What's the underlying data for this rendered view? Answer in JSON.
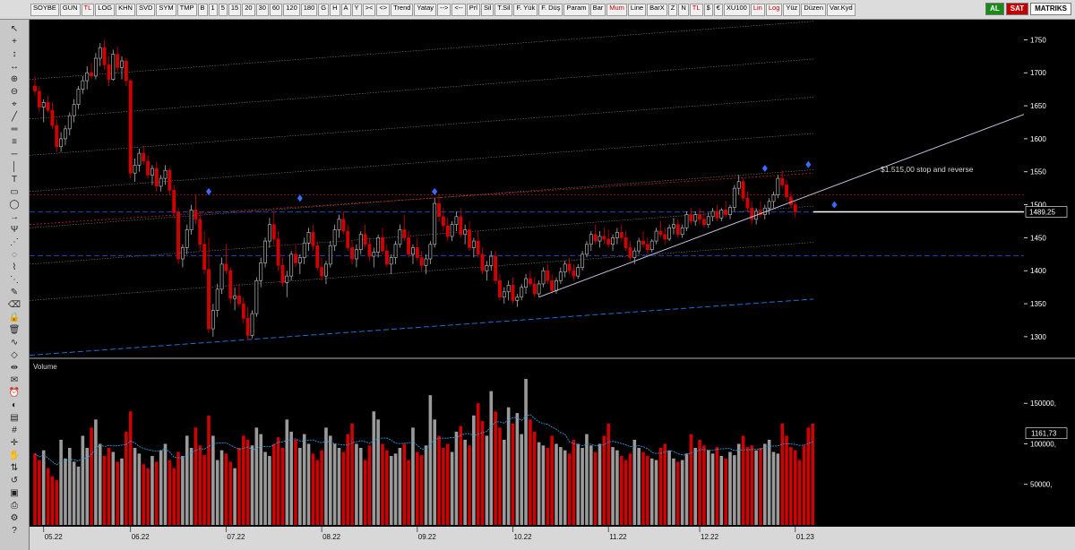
{
  "toolbar": {
    "symbol": "SOYBE",
    "period": "GUN",
    "currency": "TL",
    "row1": [
      "B",
      "1",
      "5",
      "15",
      "20",
      "30",
      "60",
      "120",
      "180",
      "G",
      "H",
      "A",
      "Y",
      "><",
      "<>",
      "Trend",
      "Yatay",
      "-->",
      "<--",
      "Prl",
      "Sil",
      "T.Sil",
      "F. Yük",
      "F. Düş",
      "Param",
      "Bar",
      "Mum",
      "Line",
      "BarX",
      "Z",
      "N",
      "TL",
      "$",
      "€",
      "XU100",
      "Lin",
      "Log",
      "Yüz",
      "Düzen",
      "Var.Kyd"
    ],
    "row0": [
      "LOG",
      "KHN",
      "SVD",
      "SYM",
      "TMP"
    ],
    "red_items": [
      "Mum",
      "TL",
      "Lin",
      "Log"
    ],
    "al_label": "AL",
    "sat_label": "SAT",
    "brand": "MATRIKS"
  },
  "tools": [
    "pointer",
    "plus",
    "arrow-up-down",
    "arrow-left-right",
    "zoom-icon",
    "zoom-out",
    "magnet",
    "trendline",
    "channel",
    "fib",
    "hline",
    "vline",
    "text",
    "rect",
    "ellipse",
    "arrow",
    "pitchfork",
    "gann",
    "cycle",
    "regression",
    "speedline",
    "brush",
    "eraser",
    "lock",
    "trash",
    "wave",
    "pattern",
    "measure",
    "note",
    "alarm",
    "color",
    "style",
    "grid",
    "crosshair",
    "hand",
    "scroll",
    "reset",
    "save",
    "print",
    "settings",
    "help"
  ],
  "chart_data": {
    "type": "candlestick",
    "symbol": "SOYBE",
    "price_axis": {
      "min": 1270,
      "max": 1775,
      "ticks": [
        1300,
        1350,
        1400,
        1450,
        1500,
        1550,
        1600,
        1650,
        1700,
        1750
      ]
    },
    "last_price_label": "1489,25",
    "last_price": 1489.25,
    "annotation": "$1.515,00  stop and reverse",
    "stop_level": 1515,
    "levels": [
      1489,
      1423
    ],
    "x_labels": [
      "05.22",
      "06.22",
      "07.22",
      "08.22",
      "09.22",
      "10.22",
      "11.22",
      "12.22",
      "01.23"
    ],
    "x_label_index": [
      2,
      22,
      44,
      66,
      88,
      110,
      132,
      153,
      175
    ],
    "candles_count": 184,
    "swing_markers": [
      {
        "index": 40,
        "price": 1520
      },
      {
        "index": 61,
        "price": 1510
      },
      {
        "index": 92,
        "price": 1520
      },
      {
        "index": 168,
        "price": 1555
      },
      {
        "index": 178,
        "price": 1561
      },
      {
        "index": 184,
        "price": 1500
      }
    ],
    "ohlc": [
      [
        1680,
        1695,
        1665,
        1672
      ],
      [
        1672,
        1680,
        1640,
        1648
      ],
      [
        1648,
        1660,
        1625,
        1655
      ],
      [
        1655,
        1665,
        1640,
        1643
      ],
      [
        1643,
        1655,
        1615,
        1620
      ],
      [
        1620,
        1630,
        1580,
        1588
      ],
      [
        1588,
        1610,
        1580,
        1600
      ],
      [
        1600,
        1620,
        1590,
        1615
      ],
      [
        1615,
        1640,
        1605,
        1635
      ],
      [
        1635,
        1660,
        1625,
        1652
      ],
      [
        1652,
        1680,
        1645,
        1675
      ],
      [
        1675,
        1695,
        1668,
        1688
      ],
      [
        1688,
        1710,
        1675,
        1700
      ],
      [
        1700,
        1715,
        1690,
        1695
      ],
      [
        1695,
        1730,
        1690,
        1722
      ],
      [
        1722,
        1745,
        1710,
        1738
      ],
      [
        1738,
        1750,
        1705,
        1712
      ],
      [
        1712,
        1725,
        1680,
        1690
      ],
      [
        1690,
        1735,
        1688,
        1728
      ],
      [
        1728,
        1740,
        1700,
        1708
      ],
      [
        1708,
        1725,
        1690,
        1718
      ],
      [
        1718,
        1722,
        1680,
        1688
      ],
      [
        1688,
        1690,
        1540,
        1548
      ],
      [
        1548,
        1570,
        1535,
        1560
      ],
      [
        1560,
        1585,
        1550,
        1578
      ],
      [
        1578,
        1590,
        1560,
        1566
      ],
      [
        1566,
        1575,
        1540,
        1545
      ],
      [
        1545,
        1560,
        1530,
        1555
      ],
      [
        1555,
        1565,
        1520,
        1528
      ],
      [
        1528,
        1545,
        1520,
        1540
      ],
      [
        1540,
        1560,
        1530,
        1552
      ],
      [
        1552,
        1555,
        1515,
        1522
      ],
      [
        1522,
        1530,
        1480,
        1488
      ],
      [
        1488,
        1495,
        1410,
        1418
      ],
      [
        1418,
        1440,
        1405,
        1435
      ],
      [
        1435,
        1470,
        1425,
        1462
      ],
      [
        1462,
        1500,
        1455,
        1492
      ],
      [
        1492,
        1515,
        1470,
        1478
      ],
      [
        1478,
        1490,
        1430,
        1440
      ],
      [
        1440,
        1460,
        1395,
        1402
      ],
      [
        1402,
        1450,
        1305,
        1312
      ],
      [
        1312,
        1350,
        1300,
        1340
      ],
      [
        1340,
        1380,
        1330,
        1372
      ],
      [
        1372,
        1420,
        1365,
        1410
      ],
      [
        1410,
        1440,
        1395,
        1400
      ],
      [
        1400,
        1405,
        1350,
        1358
      ],
      [
        1358,
        1375,
        1340,
        1362
      ],
      [
        1362,
        1380,
        1345,
        1350
      ],
      [
        1350,
        1360,
        1320,
        1328
      ],
      [
        1328,
        1345,
        1295,
        1302
      ],
      [
        1302,
        1340,
        1298,
        1335
      ],
      [
        1335,
        1390,
        1330,
        1385
      ],
      [
        1385,
        1420,
        1375,
        1412
      ],
      [
        1412,
        1450,
        1405,
        1445
      ],
      [
        1445,
        1480,
        1435,
        1470
      ],
      [
        1470,
        1490,
        1440,
        1448
      ],
      [
        1448,
        1460,
        1400,
        1408
      ],
      [
        1408,
        1420,
        1375,
        1382
      ],
      [
        1382,
        1400,
        1360,
        1392
      ],
      [
        1392,
        1430,
        1385,
        1425
      ],
      [
        1425,
        1440,
        1405,
        1412
      ],
      [
        1412,
        1425,
        1395,
        1420
      ],
      [
        1420,
        1450,
        1410,
        1442
      ],
      [
        1442,
        1465,
        1430,
        1458
      ],
      [
        1458,
        1470,
        1430,
        1438
      ],
      [
        1438,
        1445,
        1400,
        1405
      ],
      [
        1405,
        1420,
        1385,
        1392
      ],
      [
        1392,
        1415,
        1380,
        1410
      ],
      [
        1410,
        1445,
        1405,
        1438
      ],
      [
        1438,
        1470,
        1430,
        1462
      ],
      [
        1462,
        1485,
        1450,
        1478
      ],
      [
        1478,
        1490,
        1455,
        1460
      ],
      [
        1460,
        1470,
        1430,
        1435
      ],
      [
        1435,
        1445,
        1410,
        1418
      ],
      [
        1418,
        1440,
        1405,
        1432
      ],
      [
        1432,
        1460,
        1425,
        1455
      ],
      [
        1455,
        1470,
        1435,
        1440
      ],
      [
        1440,
        1450,
        1415,
        1422
      ],
      [
        1422,
        1435,
        1405,
        1428
      ],
      [
        1428,
        1455,
        1420,
        1450
      ],
      [
        1450,
        1465,
        1425,
        1430
      ],
      [
        1430,
        1440,
        1405,
        1410
      ],
      [
        1410,
        1425,
        1395,
        1420
      ],
      [
        1420,
        1445,
        1410,
        1440
      ],
      [
        1440,
        1470,
        1435,
        1462
      ],
      [
        1462,
        1485,
        1445,
        1450
      ],
      [
        1450,
        1460,
        1420,
        1425
      ],
      [
        1425,
        1440,
        1410,
        1435
      ],
      [
        1435,
        1450,
        1415,
        1420
      ],
      [
        1420,
        1430,
        1400,
        1408
      ],
      [
        1408,
        1425,
        1395,
        1418
      ],
      [
        1418,
        1445,
        1410,
        1440
      ],
      [
        1440,
        1510,
        1435,
        1502
      ],
      [
        1502,
        1515,
        1475,
        1482
      ],
      [
        1482,
        1495,
        1460,
        1468
      ],
      [
        1468,
        1480,
        1445,
        1452
      ],
      [
        1452,
        1475,
        1445,
        1470
      ],
      [
        1470,
        1490,
        1460,
        1482
      ],
      [
        1482,
        1495,
        1450,
        1455
      ],
      [
        1455,
        1470,
        1440,
        1462
      ],
      [
        1462,
        1475,
        1430,
        1435
      ],
      [
        1435,
        1450,
        1420,
        1445
      ],
      [
        1445,
        1460,
        1420,
        1425
      ],
      [
        1425,
        1435,
        1395,
        1400
      ],
      [
        1400,
        1415,
        1385,
        1408
      ],
      [
        1408,
        1430,
        1400,
        1422
      ],
      [
        1422,
        1430,
        1380,
        1385
      ],
      [
        1385,
        1395,
        1355,
        1360
      ],
      [
        1360,
        1375,
        1350,
        1368
      ],
      [
        1368,
        1385,
        1355,
        1378
      ],
      [
        1378,
        1390,
        1350,
        1355
      ],
      [
        1355,
        1365,
        1345,
        1360
      ],
      [
        1360,
        1380,
        1355,
        1375
      ],
      [
        1375,
        1395,
        1365,
        1388
      ],
      [
        1388,
        1400,
        1375,
        1380
      ],
      [
        1380,
        1390,
        1360,
        1365
      ],
      [
        1365,
        1385,
        1360,
        1380
      ],
      [
        1380,
        1405,
        1375,
        1400
      ],
      [
        1400,
        1410,
        1380,
        1385
      ],
      [
        1385,
        1395,
        1365,
        1370
      ],
      [
        1370,
        1390,
        1365,
        1385
      ],
      [
        1385,
        1405,
        1380,
        1398
      ],
      [
        1398,
        1415,
        1390,
        1410
      ],
      [
        1410,
        1420,
        1395,
        1400
      ],
      [
        1400,
        1410,
        1385,
        1392
      ],
      [
        1392,
        1410,
        1388,
        1405
      ],
      [
        1405,
        1430,
        1400,
        1425
      ],
      [
        1425,
        1445,
        1420,
        1440
      ],
      [
        1440,
        1460,
        1430,
        1455
      ],
      [
        1455,
        1470,
        1440,
        1445
      ],
      [
        1445,
        1460,
        1435,
        1452
      ],
      [
        1452,
        1465,
        1440,
        1448
      ],
      [
        1448,
        1462,
        1435,
        1440
      ],
      [
        1440,
        1455,
        1430,
        1450
      ],
      [
        1450,
        1465,
        1440,
        1458
      ],
      [
        1458,
        1470,
        1445,
        1450
      ],
      [
        1450,
        1460,
        1430,
        1435
      ],
      [
        1435,
        1445,
        1415,
        1420
      ],
      [
        1420,
        1435,
        1410,
        1430
      ],
      [
        1430,
        1450,
        1425,
        1445
      ],
      [
        1445,
        1460,
        1435,
        1440
      ],
      [
        1440,
        1450,
        1425,
        1432
      ],
      [
        1432,
        1448,
        1428,
        1445
      ],
      [
        1445,
        1465,
        1440,
        1460
      ],
      [
        1460,
        1475,
        1450,
        1455
      ],
      [
        1455,
        1465,
        1440,
        1448
      ],
      [
        1448,
        1470,
        1445,
        1465
      ],
      [
        1465,
        1480,
        1455,
        1470
      ],
      [
        1470,
        1478,
        1450,
        1455
      ],
      [
        1455,
        1470,
        1450,
        1465
      ],
      [
        1465,
        1490,
        1460,
        1485
      ],
      [
        1485,
        1495,
        1470,
        1475
      ],
      [
        1475,
        1490,
        1468,
        1485
      ],
      [
        1485,
        1495,
        1470,
        1478
      ],
      [
        1478,
        1490,
        1465,
        1470
      ],
      [
        1470,
        1488,
        1465,
        1482
      ],
      [
        1482,
        1495,
        1475,
        1490
      ],
      [
        1490,
        1500,
        1475,
        1480
      ],
      [
        1480,
        1495,
        1475,
        1492
      ],
      [
        1492,
        1505,
        1480,
        1485
      ],
      [
        1485,
        1500,
        1478,
        1496
      ],
      [
        1496,
        1530,
        1490,
        1525
      ],
      [
        1525,
        1545,
        1515,
        1535
      ],
      [
        1535,
        1540,
        1505,
        1510
      ],
      [
        1510,
        1520,
        1490,
        1495
      ],
      [
        1495,
        1505,
        1470,
        1478
      ],
      [
        1478,
        1495,
        1470,
        1490
      ],
      [
        1490,
        1505,
        1480,
        1485
      ],
      [
        1485,
        1500,
        1478,
        1495
      ],
      [
        1495,
        1510,
        1485,
        1505
      ],
      [
        1505,
        1520,
        1495,
        1515
      ],
      [
        1515,
        1545,
        1510,
        1540
      ],
      [
        1540,
        1552,
        1525,
        1530
      ],
      [
        1530,
        1538,
        1505,
        1512
      ],
      [
        1512,
        1520,
        1495,
        1500
      ],
      [
        1500,
        1505,
        1480,
        1489
      ]
    ],
    "volume_panel": {
      "title": "Volume",
      "ticks": [
        50000,
        100000,
        150000
      ],
      "tick_labels": [
        "50000,",
        "100000,",
        "150000,"
      ],
      "last_label": "1161,73",
      "max": 190000,
      "values": [
        88000,
        80000,
        92000,
        70000,
        60000,
        55000,
        105000,
        82000,
        95000,
        78000,
        72000,
        110000,
        95000,
        120000,
        130000,
        100000,
        85000,
        95000,
        90000,
        78000,
        82000,
        115000,
        140000,
        95000,
        88000,
        75000,
        70000,
        85000,
        78000,
        92000,
        100000,
        80000,
        70000,
        90000,
        85000,
        110000,
        95000,
        120000,
        98000,
        86000,
        135000,
        110000,
        80000,
        92000,
        88000,
        78000,
        70000,
        95000,
        110000,
        105000,
        98000,
        120000,
        112000,
        90000,
        85000,
        100000,
        108000,
        95000,
        130000,
        115000,
        105000,
        95000,
        112000,
        100000,
        88000,
        80000,
        92000,
        120000,
        110000,
        100000,
        95000,
        90000,
        112000,
        125000,
        100000,
        95000,
        80000,
        98000,
        140000,
        130000,
        100000,
        92000,
        85000,
        88000,
        95000,
        100000,
        80000,
        120000,
        90000,
        86000,
        98000,
        160000,
        130000,
        110000,
        95000,
        100000,
        90000,
        115000,
        122000,
        105000,
        98000,
        135000,
        150000,
        128000,
        110000,
        165000,
        140000,
        120000,
        105000,
        145000,
        125000,
        138000,
        112000,
        180000,
        130000,
        115000,
        102000,
        98000,
        95000,
        110000,
        100000,
        96000,
        92000,
        88000,
        105000,
        100000,
        95000,
        112000,
        98000,
        90000,
        100000,
        110000,
        125000,
        96000,
        92000,
        85000,
        80000,
        88000,
        105000,
        95000,
        90000,
        85000,
        82000,
        80000,
        95000,
        100000,
        92000,
        82000,
        78000,
        80000,
        88000,
        112000,
        95000,
        105000,
        98000,
        92000,
        88000,
        96000,
        85000,
        82000,
        90000,
        86000,
        100000,
        110000,
        96000,
        98000,
        92000,
        95000,
        100000,
        105000,
        90000,
        88000,
        125000,
        110000,
        96000,
        92000,
        80000,
        98000,
        120000,
        125000
      ],
      "ma_label": "MA"
    }
  }
}
